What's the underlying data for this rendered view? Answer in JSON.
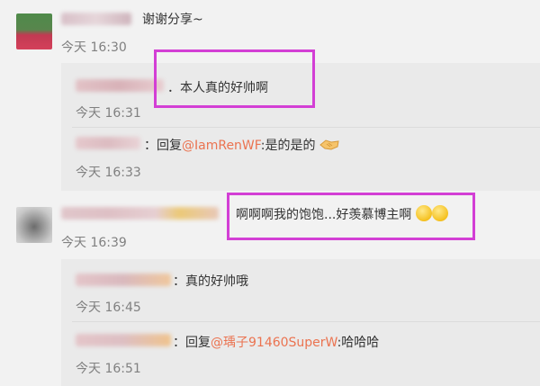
{
  "comments": [
    {
      "text": "谢谢分享~",
      "time": "今天 16:30"
    },
    {
      "text": "啊啊啊我的饱饱...好羡慕博主啊",
      "time": "今天 16:39"
    }
  ],
  "replies": [
    {
      "text": "．本人真的好帅啊",
      "time": "今天 16:31"
    },
    {
      "prefix": "：回复",
      "mention": "@IamRenWF",
      "suffix": ":是的是的",
      "time": "今天 16:33"
    },
    {
      "text": "：真的好帅哦",
      "time": "今天 16:45"
    },
    {
      "prefix": "：回复",
      "mention": "@瑀子91460SuperW",
      "suffix": ":哈哈哈",
      "time": "今天 16:51"
    }
  ],
  "icons": [
    "handshake-icon",
    "smile-emoji-icon"
  ],
  "colors": {
    "mention": "#eb7350",
    "highlight": "#d33fd5",
    "background": "#f2f2f2",
    "reply_bg": "#eaeaea"
  }
}
